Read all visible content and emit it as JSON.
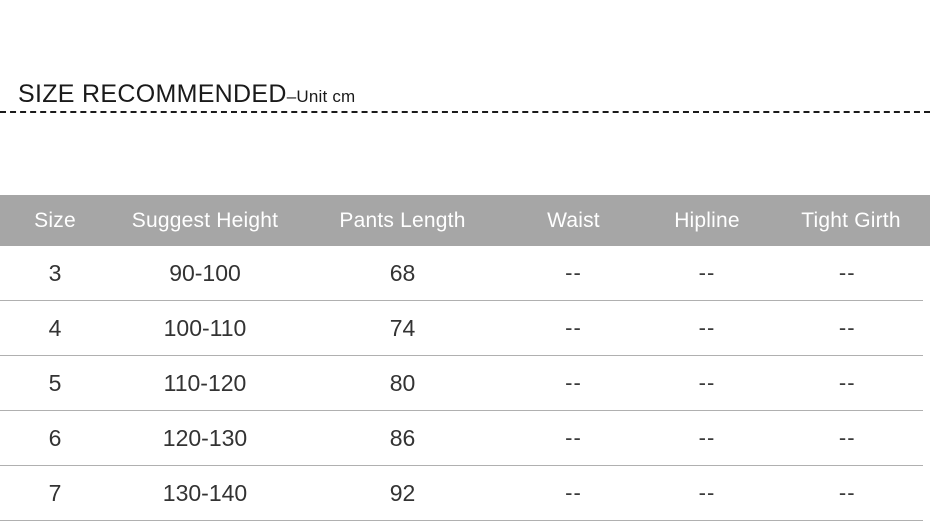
{
  "header": {
    "title": "SIZE  RECOMMENDED",
    "unit_note": "–Unit cm"
  },
  "colors": {
    "header_row_bg": "#a6a6a6",
    "header_row_text": "#ffffff",
    "body_text": "#333333",
    "divider": "#b0b0b0",
    "title_text": "#1a1a1a",
    "page_bg": "#ffffff"
  },
  "table": {
    "columns": [
      {
        "key": "size",
        "label": "Size"
      },
      {
        "key": "height",
        "label": "Suggest Height"
      },
      {
        "key": "pants",
        "label": "Pants Length"
      },
      {
        "key": "waist",
        "label": "Waist"
      },
      {
        "key": "hipline",
        "label": "Hipline"
      },
      {
        "key": "girth",
        "label": "Tight Girth"
      }
    ],
    "rows": [
      {
        "size": "3",
        "height": "90-100",
        "pants": "68",
        "waist": "--",
        "hipline": "--",
        "girth": "--"
      },
      {
        "size": "4",
        "height": "100-110",
        "pants": "74",
        "waist": "--",
        "hipline": "--",
        "girth": "--"
      },
      {
        "size": "5",
        "height": "110-120",
        "pants": "80",
        "waist": "--",
        "hipline": "--",
        "girth": "--"
      },
      {
        "size": "6",
        "height": "120-130",
        "pants": "86",
        "waist": "--",
        "hipline": "--",
        "girth": "--"
      },
      {
        "size": "7",
        "height": "130-140",
        "pants": "92",
        "waist": "--",
        "hipline": "--",
        "girth": "--"
      }
    ]
  },
  "chart_data": {
    "type": "table",
    "title": "SIZE  RECOMMENDED–Unit cm",
    "columns": [
      "Size",
      "Suggest Height",
      "Pants Length",
      "Waist",
      "Hipline",
      "Tight Girth"
    ],
    "rows": [
      [
        "3",
        "90-100",
        "68",
        "--",
        "--",
        "--"
      ],
      [
        "4",
        "100-110",
        "74",
        "--",
        "--",
        "--"
      ],
      [
        "5",
        "110-120",
        "80",
        "--",
        "--",
        "--"
      ],
      [
        "6",
        "120-130",
        "86",
        "--",
        "--",
        "--"
      ],
      [
        "7",
        "130-140",
        "92",
        "--",
        "--",
        "--"
      ]
    ],
    "units": "cm"
  }
}
